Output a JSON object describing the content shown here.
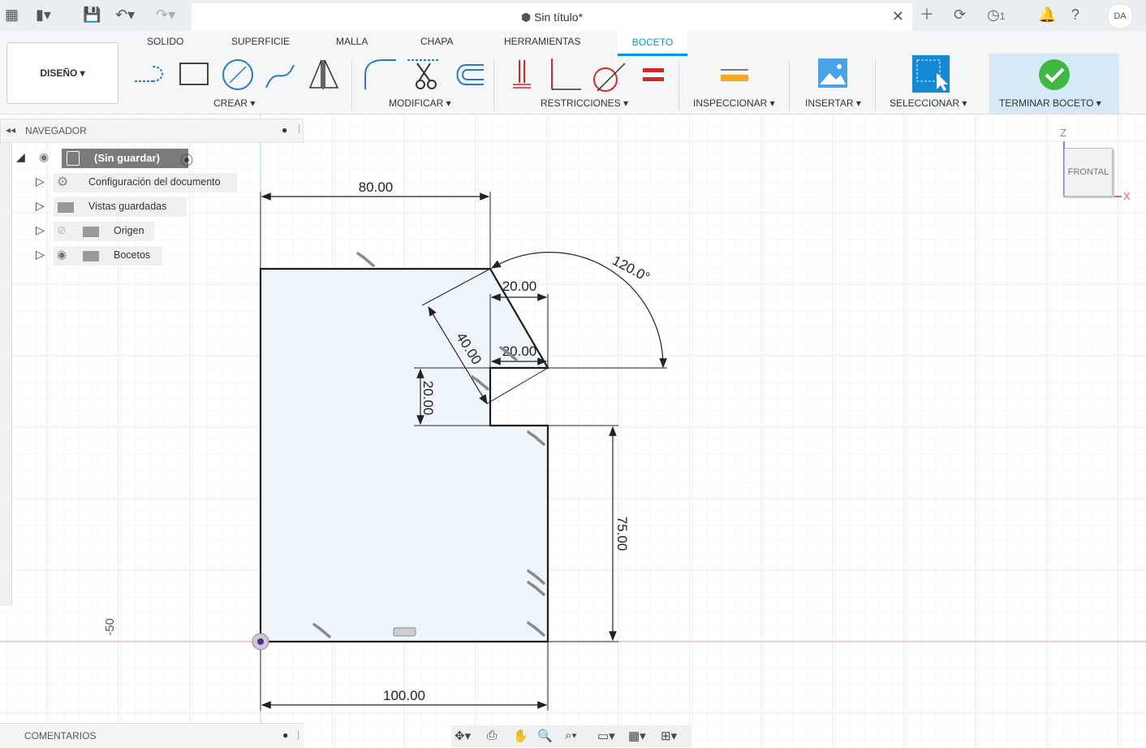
{
  "topbar": {
    "doc_title": "Sin título*",
    "jobs_count": "1",
    "avatar_initials": "DA"
  },
  "ribbon": {
    "tabs": [
      "SOLIDO",
      "SUPERFICIE",
      "MALLA",
      "CHAPA",
      "HERRAMIENTAS",
      "BOCETO"
    ],
    "active_tab": "BOCETO",
    "workspace": "DISEÑO ▾",
    "groups": {
      "crear": "CREAR ▾",
      "modificar": "MODIFICAR ▾",
      "restricciones": "RESTRICCIONES ▾",
      "inspeccionar": "INSPECCIONAR ▾",
      "insertar": "INSERTAR ▾",
      "seleccionar": "SELECCIONAR ▾",
      "terminar": "TERMINAR BOCETO ▾"
    }
  },
  "navigator": {
    "title": "NAVEGADOR",
    "root": "(Sin guardar)",
    "items": [
      "Configuración del documento",
      "Vistas guardadas",
      "Origen",
      "Bocetos"
    ]
  },
  "viewcube": {
    "face": "FRONTAL",
    "axis_z": "Z",
    "axis_x": "X"
  },
  "sketch": {
    "dimensions": {
      "top_width": "80.00",
      "bottom_width": "100.00",
      "step_top": "20.00",
      "step_mid": "20.00",
      "slant_length": "40.00",
      "step_height": "20.00",
      "right_height": "75.00",
      "angle": "120.0°"
    },
    "ruler_label": "-50"
  },
  "comments": {
    "title": "COMENTARIOS"
  },
  "colors": {
    "accent": "#0696d7",
    "profile_fill": "#eef5fb",
    "grid": "#e4e4e4",
    "axis_red": "#e06666",
    "axis_green": "#6ccf6c",
    "finish_green": "#3fb943"
  }
}
